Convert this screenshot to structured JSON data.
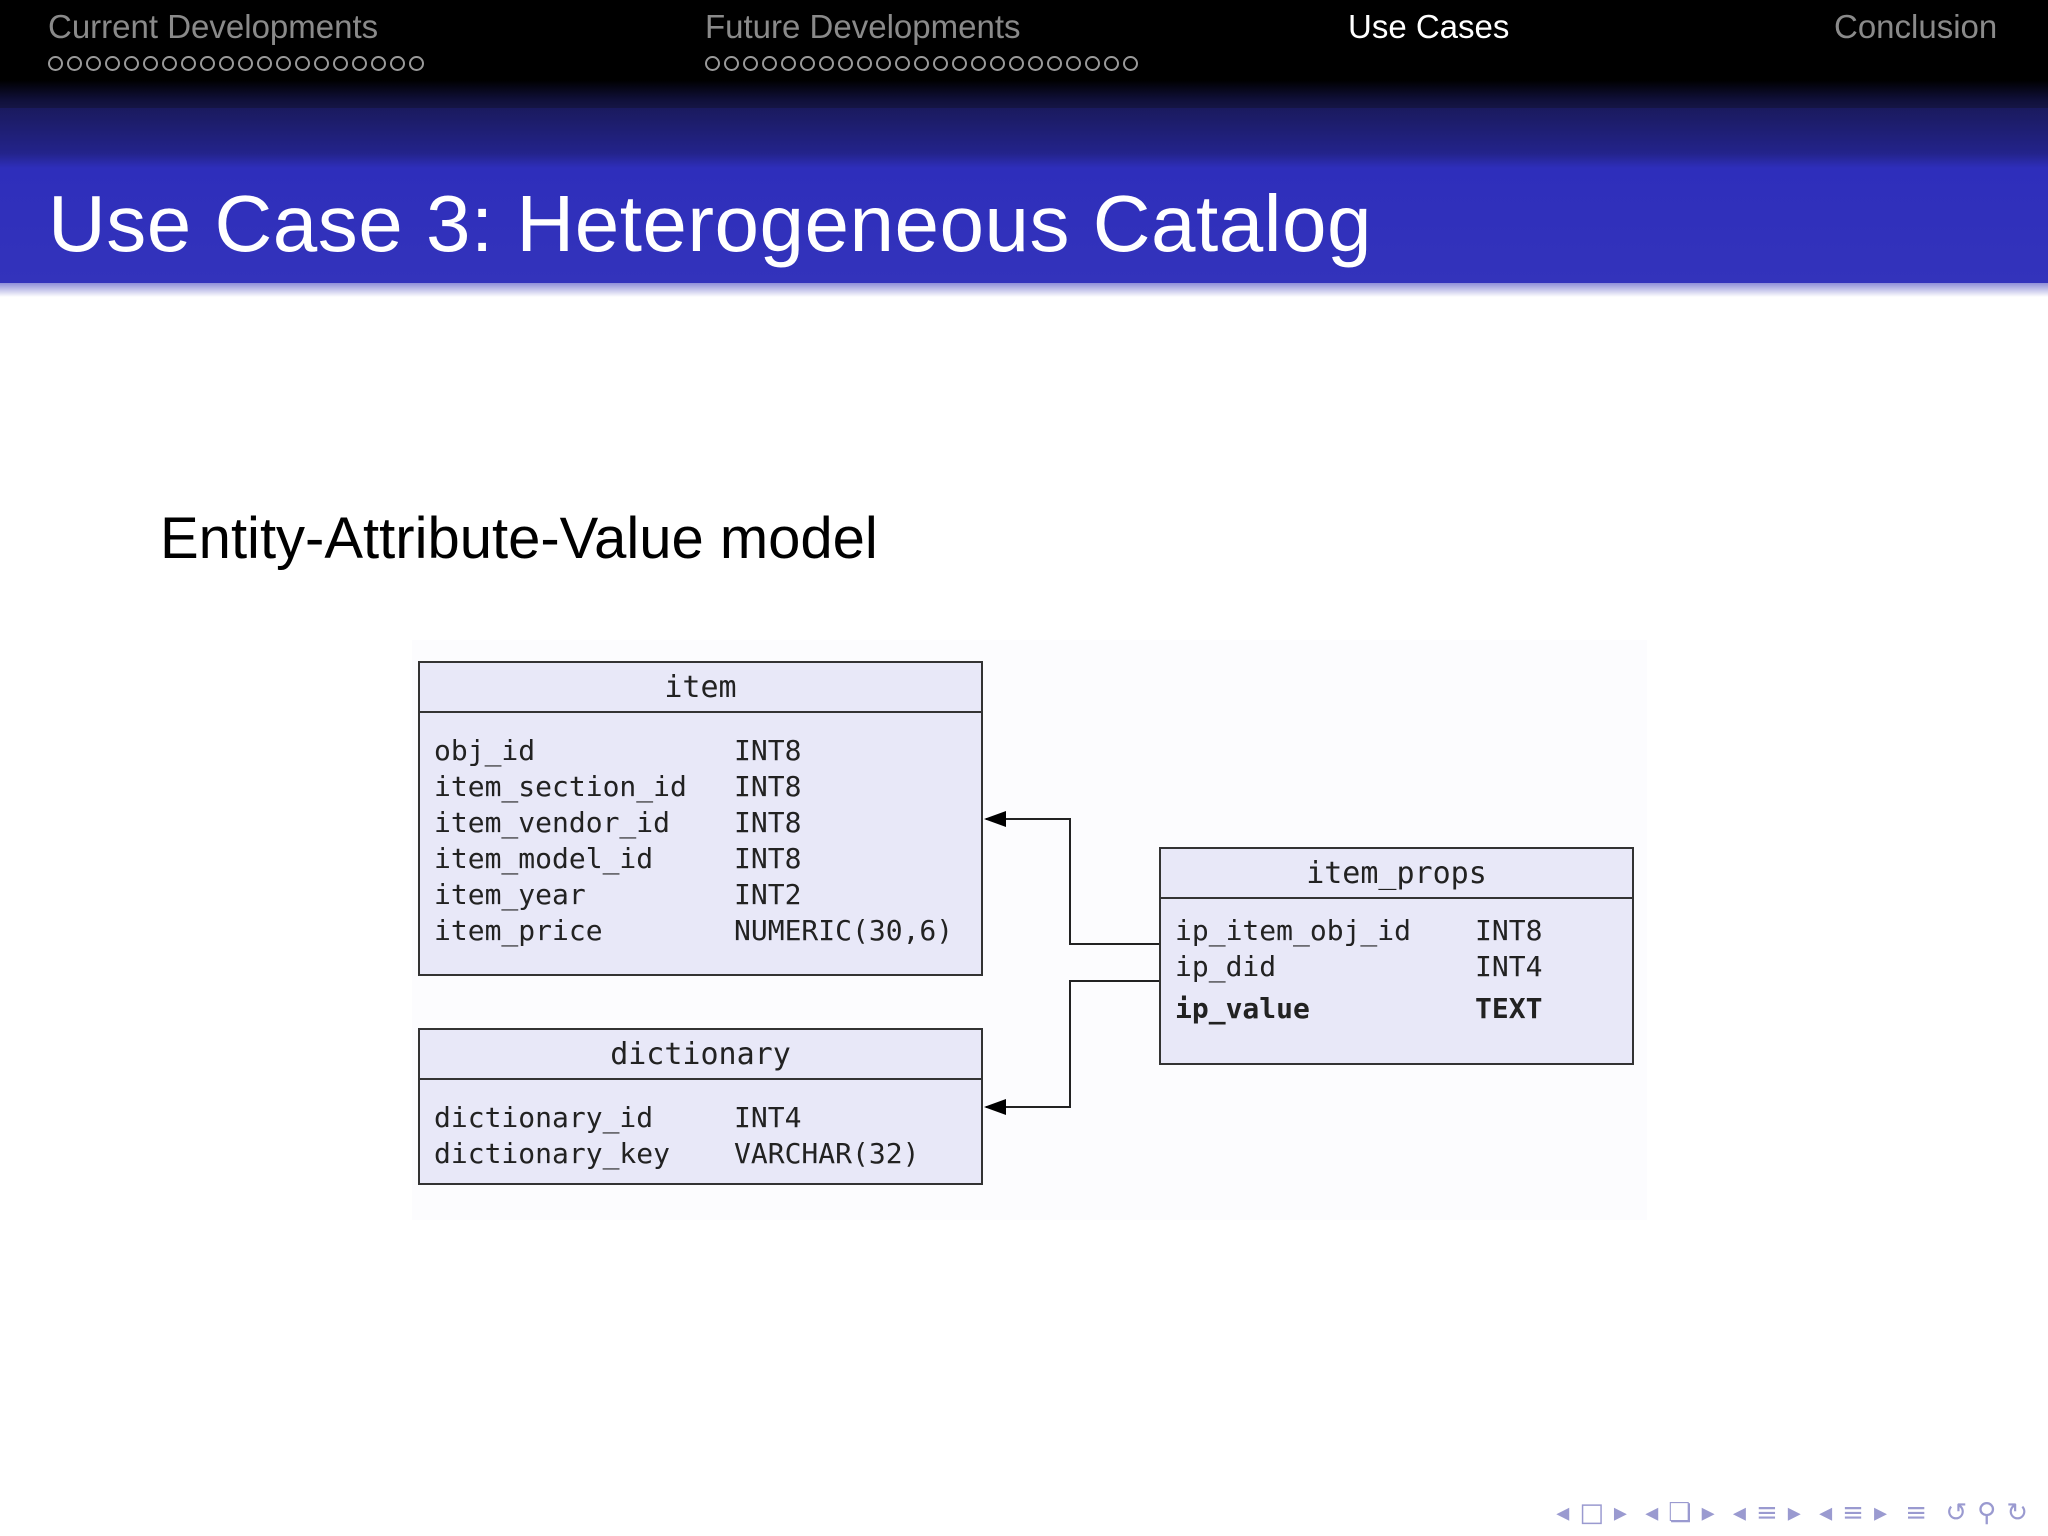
{
  "nav": {
    "sections": [
      {
        "title": "Current Developments",
        "dots": 20,
        "active": false
      },
      {
        "title": "Future Developments",
        "dots": 23,
        "active": false
      },
      {
        "title": "Use Cases",
        "dots": 0,
        "active": true
      },
      {
        "title": "Conclusion",
        "dots": 0,
        "active": false
      }
    ]
  },
  "slide": {
    "title": "Use Case 3: Heterogeneous Catalog",
    "subheading": "Entity-Attribute-Value model"
  },
  "diagram": {
    "tables": {
      "item": {
        "name": "item",
        "columns": [
          {
            "name": "obj_id",
            "type": "INT8"
          },
          {
            "name": "item_section_id",
            "type": "INT8"
          },
          {
            "name": "item_vendor_id",
            "type": "INT8"
          },
          {
            "name": "item_model_id",
            "type": "INT8"
          },
          {
            "name": "item_year",
            "type": "INT2"
          },
          {
            "name": "item_price",
            "type": "NUMERIC(30,6)"
          }
        ]
      },
      "dictionary": {
        "name": "dictionary",
        "columns": [
          {
            "name": "dictionary_id",
            "type": "INT4"
          },
          {
            "name": "dictionary_key",
            "type": "VARCHAR(32)"
          }
        ]
      },
      "item_props": {
        "name": "item_props",
        "columns": [
          {
            "name": "ip_item_obj_id",
            "type": "INT8"
          },
          {
            "name": "ip_did",
            "type": "INT4"
          },
          {
            "name": "ip_value",
            "type": "TEXT"
          }
        ]
      }
    }
  },
  "footer": {
    "icons": [
      "nav-left-icon",
      "frame-icon",
      "nav-right-icon",
      "nav-left-icon",
      "subsection-icon",
      "nav-right-icon",
      "nav-left-icon",
      "section-icon",
      "nav-right-icon",
      "nav-left-icon",
      "section-icon",
      "nav-right-icon",
      "align-icon",
      "undo-icon",
      "search-icon",
      "redo-icon"
    ]
  }
}
